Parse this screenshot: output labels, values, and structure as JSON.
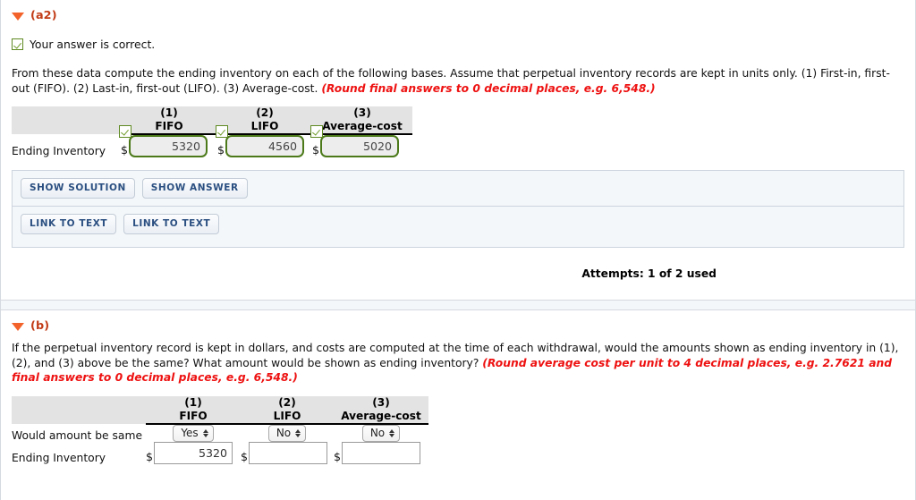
{
  "sections": [
    {
      "id": "a2",
      "label": "(a2)",
      "feedback": "Your answer is correct.",
      "prompt_plain": "From these data compute the ending inventory on each of the following bases. Assume that perpetual inventory records are kept in units only. (1) First-in, first-out (FIFO). (2) Last-in, first-out (LIFO). (3) Average-cost.",
      "prompt_hint": "(Round final answers to 0 decimal places, e.g. 6,548.)",
      "table": {
        "columns": [
          {
            "num": "(1)",
            "name": "FIFO"
          },
          {
            "num": "(2)",
            "name": "LIFO"
          },
          {
            "num": "(3)",
            "name": "Average-cost"
          }
        ],
        "row_label": "Ending Inventory",
        "currency": "$",
        "values": [
          "5320",
          "4560",
          "5020"
        ]
      },
      "buttons_row1": [
        "SHOW SOLUTION",
        "SHOW ANSWER"
      ],
      "buttons_row2": [
        "LINK TO TEXT",
        "LINK TO TEXT"
      ],
      "attempts": "Attempts: 1 of 2 used"
    },
    {
      "id": "b",
      "label": "(b)",
      "prompt_plain": "If the perpetual inventory record is kept in dollars, and costs are computed at the time of each withdrawal, would the amounts shown as ending inventory in (1), (2), and (3) above be the same? What amount would be shown as ending inventory?",
      "prompt_hint": "(Round average cost per unit to 4 decimal places, e.g. 2.7621 and final answers to 0 decimal places, e.g. 6,548.)",
      "table": {
        "columns": [
          {
            "num": "(1)",
            "name": "FIFO"
          },
          {
            "num": "(2)",
            "name": "LIFO"
          },
          {
            "num": "(3)",
            "name": "Average-cost"
          }
        ],
        "row1_label": "Would amount be same",
        "row2_label": "Ending Inventory",
        "currency": "$",
        "selects": [
          "Yes",
          "No",
          "No"
        ],
        "select_options": [
          "Yes",
          "No"
        ],
        "values": [
          "5320",
          "",
          ""
        ]
      }
    }
  ],
  "colors": {
    "section_label": "#c23c17",
    "triangle": "#f2622a",
    "hint_red": "#ee1111",
    "valid_green": "#4c7a1a",
    "button_text": "#2b4f81",
    "panel_bg": "#f4f7fa",
    "header_bg": "#e3e3e3"
  }
}
